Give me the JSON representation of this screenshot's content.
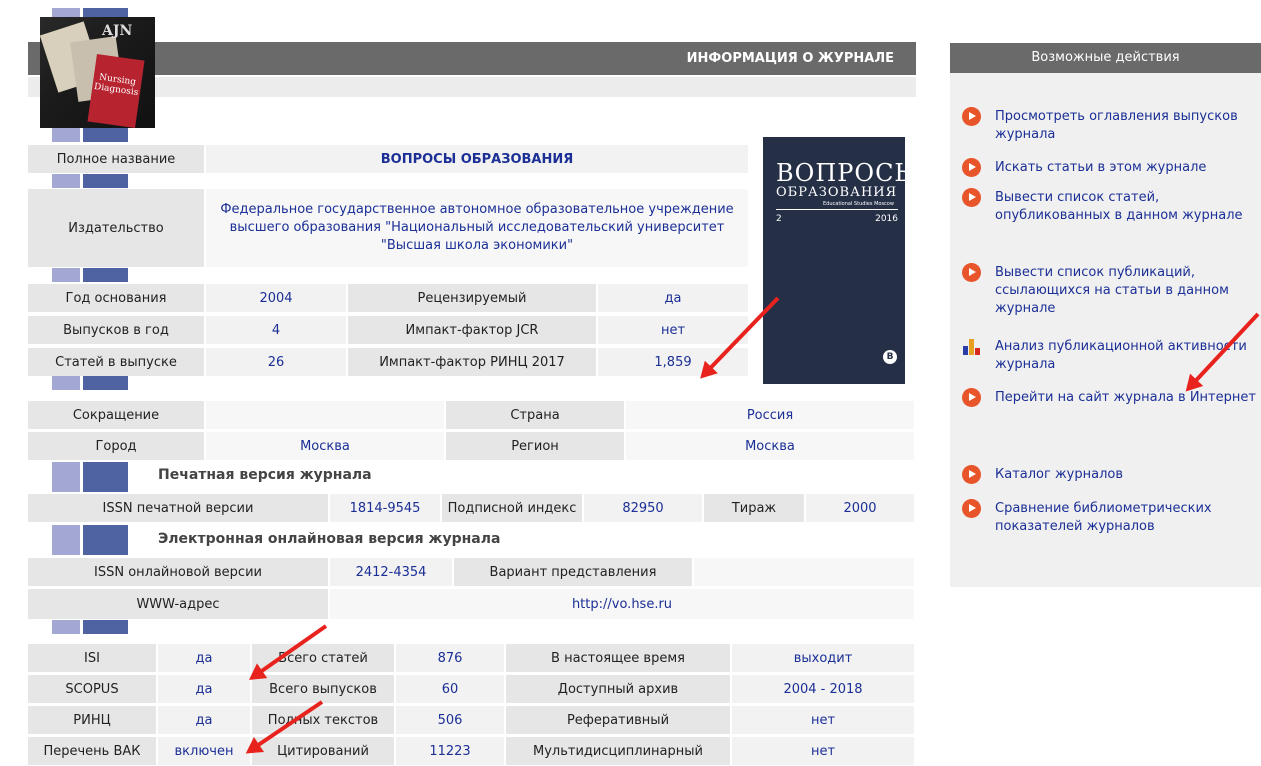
{
  "header": {
    "title": "ИНФОРМАЦИЯ О ЖУРНАЛЕ"
  },
  "thumb": {
    "line1": "AJN",
    "line2": "Nursing Diagnosis"
  },
  "journal": {
    "full_name_label": "Полное название",
    "full_name": "ВОПРОСЫ ОБРАЗОВАНИЯ",
    "publisher_label": "Издательство",
    "publisher": "Федеральное государственное автономное образовательное учреждение высшего образования \"Национальный исследовательский университет \"Высшая школа экономики\""
  },
  "stats1": {
    "rows": [
      {
        "l1": "Год основания",
        "v1": "2004",
        "l2": "Рецензируемый",
        "v2": "да"
      },
      {
        "l1": "Выпусков в год",
        "v1": "4",
        "l2": "Импакт-фактор JCR",
        "v2": "нет"
      },
      {
        "l1": "Статей в выпуске",
        "v1": "26",
        "l2": "Импакт-фактор РИНЦ 2017",
        "v2": "1,859"
      }
    ]
  },
  "cover": {
    "title1": "ВОПРОСЫ",
    "title2": "ОБРАЗОВАНИЯ",
    "subtitle": "Educational Studies Moscow",
    "issue": "2",
    "year": "2016",
    "logo": "B"
  },
  "geo": {
    "rows": [
      {
        "l1": "Сокращение",
        "v1": "",
        "l2": "Страна",
        "v2": "Россия"
      },
      {
        "l1": "Город",
        "v1": "Москва",
        "l2": "Регион",
        "v2": "Москва"
      }
    ]
  },
  "print": {
    "title": "Печатная версия журнала",
    "issn_label": "ISSN печатной версии",
    "issn": "1814-9545",
    "sub_label": "Подписной индекс",
    "sub": "82950",
    "run_label": "Тираж",
    "run": "2000"
  },
  "online": {
    "title": "Электронная онлайновая версия журнала",
    "issn_label": "ISSN онлайновой версии",
    "issn": "2412-4354",
    "variant_label": "Вариант представления",
    "variant": "",
    "www_label": "WWW-адрес",
    "www": "http://vo.hse.ru"
  },
  "index": {
    "rows": [
      {
        "l1": "ISI",
        "v1": "да",
        "l2": "Всего статей",
        "v2": "876",
        "l3": "В настоящее время",
        "v3": "выходит"
      },
      {
        "l1": "SCOPUS",
        "v1": "да",
        "l2": "Всего выпусков",
        "v2": "60",
        "l3": "Доступный архив",
        "v3": "2004 - 2018"
      },
      {
        "l1": "РИНЦ",
        "v1": "да",
        "l2": "Полных текстов",
        "v2": "506",
        "l3": "Реферативный",
        "v3": "нет"
      },
      {
        "l1": "Перечень ВАК",
        "v1": "включен",
        "l2": "Цитирований",
        "v2": "11223",
        "l3": "Мультидисциплинарный",
        "v3": "нет"
      }
    ]
  },
  "sidebar": {
    "title": "Возможные действия",
    "actions": [
      {
        "text": "Просмотреть оглавления выпусков журнала",
        "icon": "play-icon"
      },
      {
        "text": "Искать статьи в этом журнале",
        "icon": "play-icon"
      },
      {
        "text": "Вывести список статей, опубликованных в данном журнале",
        "icon": "play-icon"
      },
      {
        "text": "Вывести список публикаций, ссылающихся на статьи в данном журнале",
        "icon": "play-icon"
      },
      {
        "text": "Анализ публикационной активности журнала",
        "icon": "bar-chart-icon"
      },
      {
        "text": "Перейти на сайт журнала в Интернет",
        "icon": "play-icon"
      },
      {
        "text": "Каталог журналов",
        "icon": "play-icon"
      },
      {
        "text": "Сравнение библиометрических показателей журналов",
        "icon": "play-icon"
      }
    ]
  },
  "colors": {
    "link": "#1b2f96",
    "accent": "#e8552a",
    "arrow": "#e8231e",
    "header": "#6a6a6a"
  }
}
